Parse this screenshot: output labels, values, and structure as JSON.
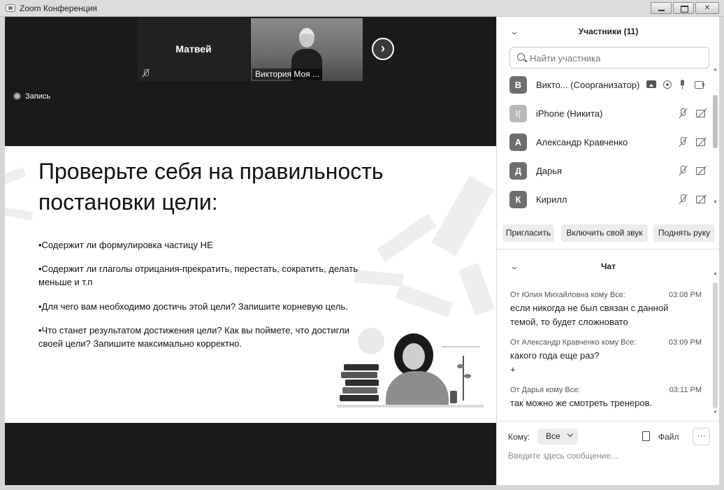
{
  "window": {
    "title": "Zoom Конференция"
  },
  "video": {
    "tiles": [
      {
        "name": "Матвей"
      },
      {
        "name": "Виктория Моя ..."
      }
    ],
    "recording_label": "Запись"
  },
  "slide": {
    "title": "Проверьте себя на правильность постановки цели:",
    "bullets": [
      "•Содержит ли формулировка частицу НЕ",
      "•Содержит ли глаголы отрицания-прекратить, перестать, сократить, делать меньше и т.п",
      "•Для чего вам необходимо достичь этой цели? Запишите корневую цель.",
      "•Что станет результатом достижения цели? Как вы поймете, что достигли своей цели? Запишите максимально корректно."
    ]
  },
  "participants": {
    "header": "Участники (11)",
    "search_placeholder": "Найти участника",
    "list": [
      {
        "initial": "В",
        "name": "Викто... (Соорганизатор)",
        "mic": "on",
        "video": "on"
      },
      {
        "initial": "I(",
        "name": "iPhone (Никита)",
        "mic": "off",
        "video": "off"
      },
      {
        "initial": "А",
        "name": "Александр Кравченко",
        "mic": "off",
        "video": "off"
      },
      {
        "initial": "Д",
        "name": "Дарья",
        "mic": "off",
        "video": "off"
      },
      {
        "initial": "К",
        "name": "Кирилл",
        "mic": "off",
        "video": "off"
      }
    ],
    "buttons": {
      "invite": "Пригласить",
      "unmute": "Включить свой звук",
      "raise_hand": "Поднять руку"
    }
  },
  "chat": {
    "header": "Чат",
    "messages": [
      {
        "meta": "От Юлия Михайловна кому Все:",
        "time": "03:08 PM",
        "text": "если никогда не был связан с данной темой, то будет сложновато"
      },
      {
        "meta": "От Александр Кравченко кому Все:",
        "time": "03:09 PM",
        "text": "какого года еще раз?\n+"
      },
      {
        "meta": "От Дарья  кому Все:",
        "time": "03:11 PM",
        "text": "так можно же смотреть тренеров."
      }
    ],
    "to_label": "Кому:",
    "to_value": "Все",
    "file_label": "Файл",
    "more_label": "···",
    "input_placeholder": "Введите здесь сообщение..."
  }
}
